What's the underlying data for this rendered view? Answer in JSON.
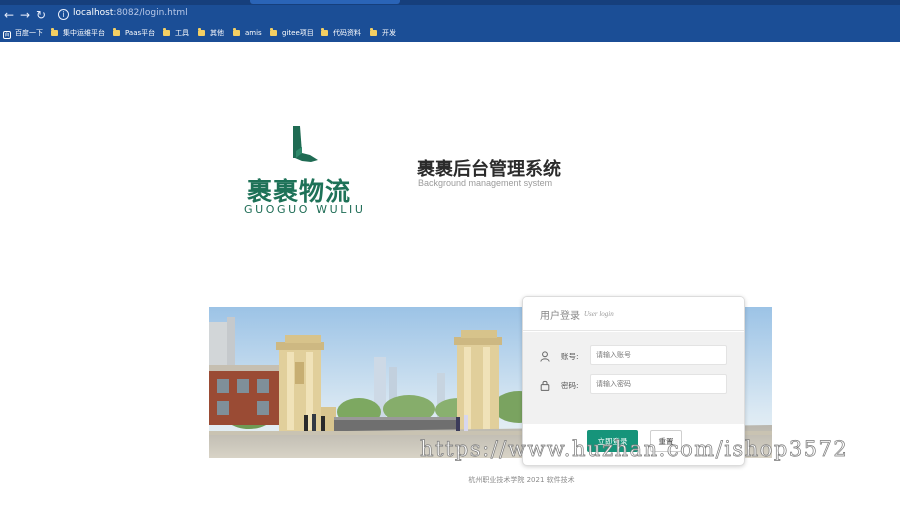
{
  "browser": {
    "url_host": "localhost",
    "url_rest": ":8082/login.html",
    "bookmarks": [
      "百度一下",
      "集中运维平台",
      "Paas平台",
      "工具",
      "其他",
      "amis",
      "gitee项目",
      "代码资料",
      "开发"
    ]
  },
  "logo": {
    "name_cn": "裹裹物流",
    "name_en": "GUOGUO WULIU"
  },
  "system": {
    "title": "裹裹后台管理系统",
    "subtitle": "Background management system"
  },
  "login": {
    "title": "用户登录",
    "title_en": "User login",
    "account_label": "账号:",
    "account_placeholder": "请输入账号",
    "password_label": "密码:",
    "password_placeholder": "请输入密码",
    "submit_label": "立即登录",
    "reset_label": "重置"
  },
  "footer": "杭州职业技术学院 2021 软件技术",
  "watermark": "https://www.huzhan.com/ishop3572",
  "colors": {
    "brand_green": "#16947a",
    "logo_green": "#1e7258",
    "browser_blue": "#1b4e96"
  },
  "icons": [
    "back-icon",
    "forward-icon",
    "reload-icon",
    "info-icon",
    "folder-icon",
    "user-icon",
    "lock-icon"
  ]
}
